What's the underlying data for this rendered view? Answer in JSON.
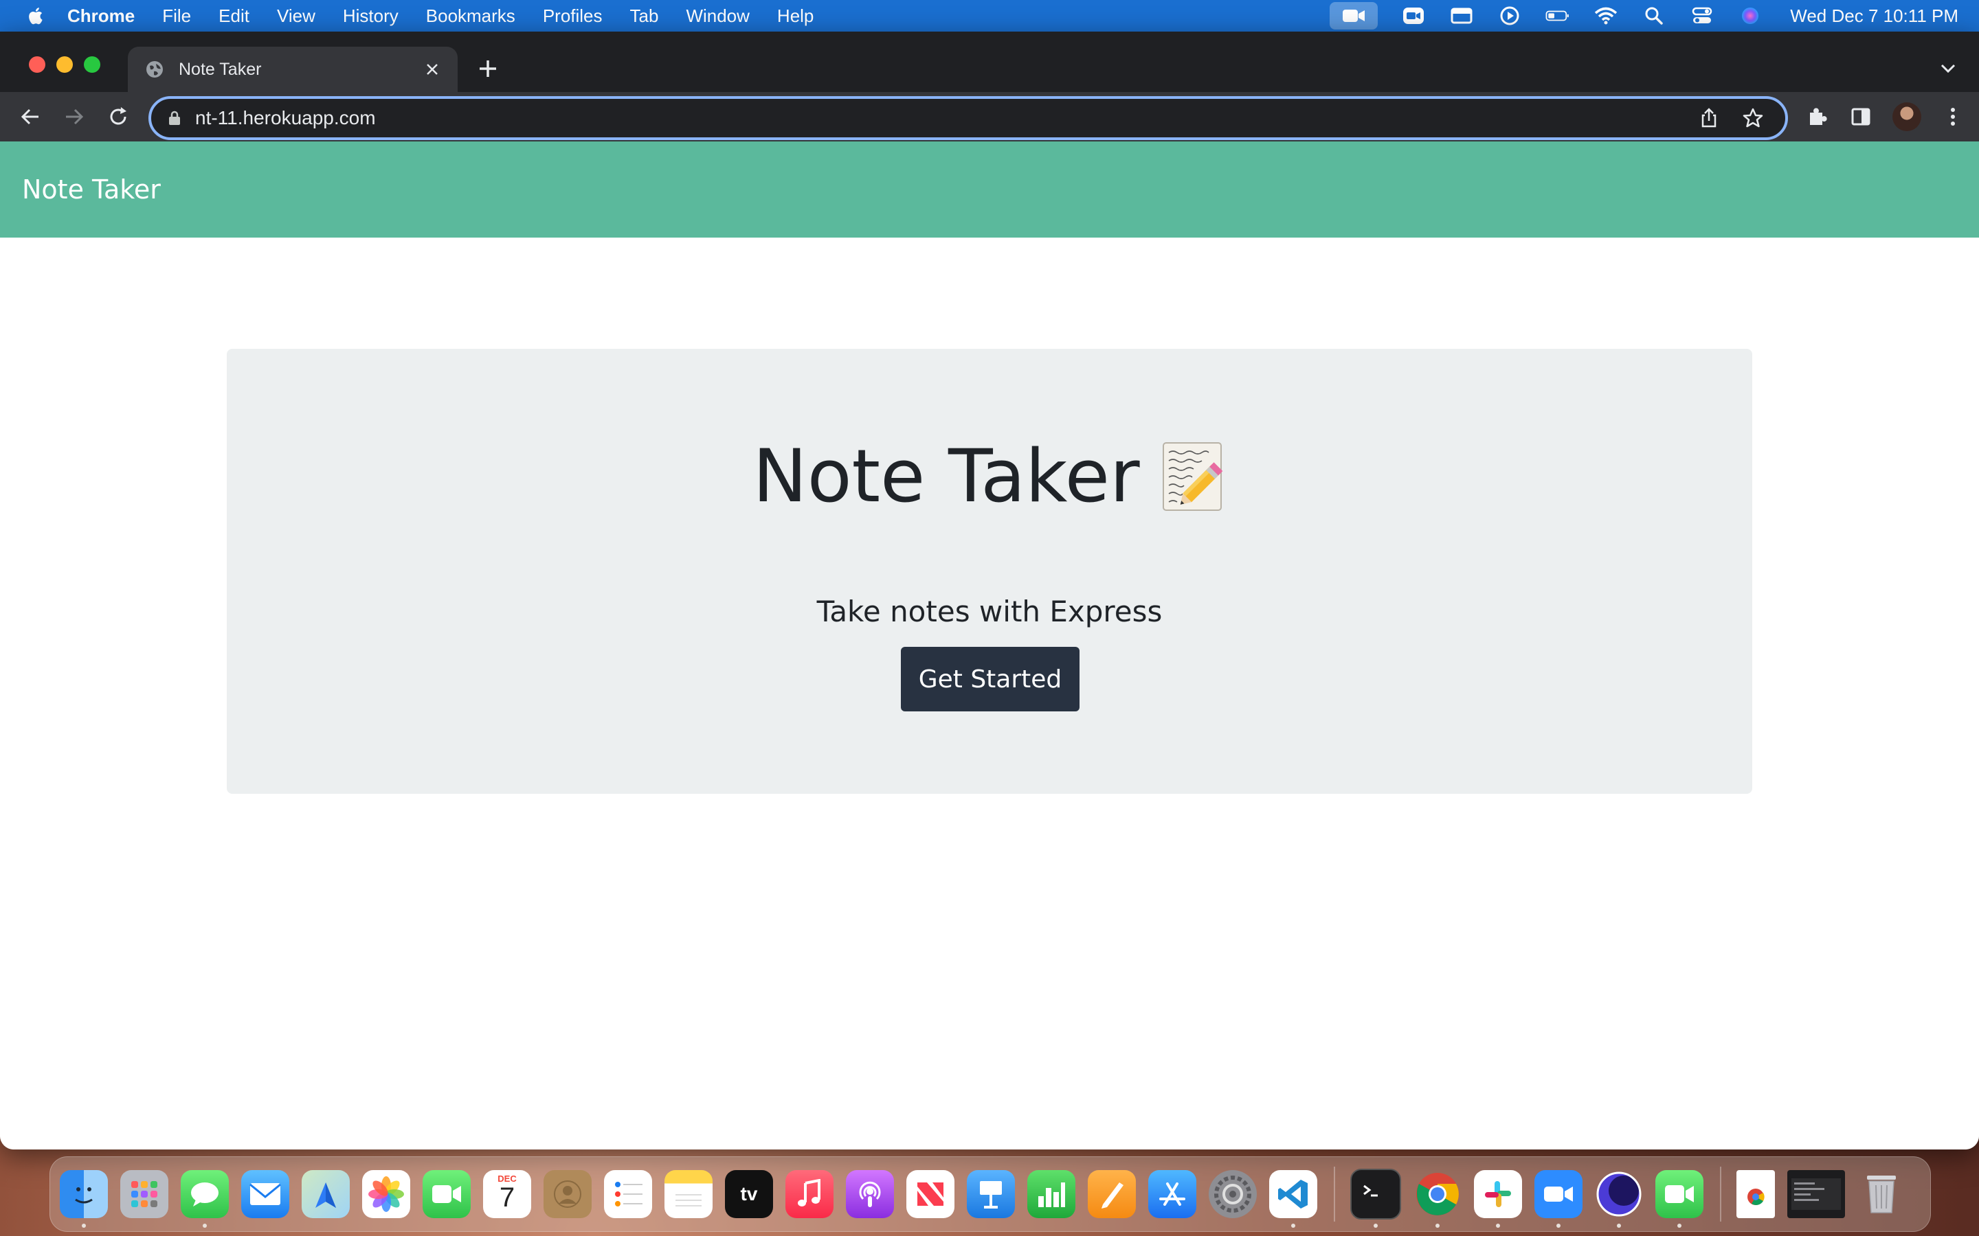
{
  "menubar": {
    "app_name": "Chrome",
    "items": [
      "File",
      "Edit",
      "View",
      "History",
      "Bookmarks",
      "Profiles",
      "Tab",
      "Window",
      "Help"
    ],
    "clock": "Wed Dec 7  10:11 PM"
  },
  "browser": {
    "tab_title": "Note Taker",
    "url": "nt-11.herokuapp.com",
    "accent_color": "#8ab4f8"
  },
  "page": {
    "navbar_brand": "Note Taker",
    "navbar_color": "#5bb99c",
    "heading": "Note Taker",
    "heading_icon": "memo-icon",
    "lead": "Take notes with Express",
    "cta_label": "Get Started",
    "cta_color": "#283241"
  },
  "dock": {
    "calendar_month": "DEC",
    "calendar_day": "7",
    "tv_label": "tv",
    "items": [
      "finder-icon",
      "launchpad-icon",
      "messages-icon",
      "mail-icon",
      "maps-icon",
      "photos-icon",
      "facetime-icon",
      "calendar-icon",
      "contacts-icon",
      "reminders-icon",
      "notes-icon",
      "appletv-icon",
      "music-icon",
      "podcasts-icon",
      "news-icon",
      "keynote-icon",
      "numbers-icon",
      "pages-icon",
      "appstore-icon",
      "system-preferences-icon",
      "vscode-icon",
      "terminal-icon",
      "chrome-icon",
      "slack-icon",
      "zoom-icon",
      "screen-recorder-icon",
      "facetime-video-icon",
      "document-icon",
      "terminal-window-icon",
      "trash-icon"
    ]
  }
}
